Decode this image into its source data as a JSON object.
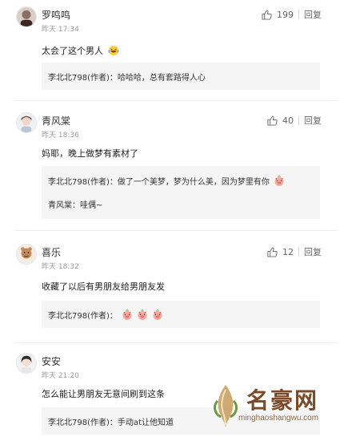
{
  "comments": [
    {
      "name": "罗鸣鸣",
      "time": "昨天 17:34",
      "likes": "199",
      "reply_label": "回复",
      "text": "太会了这个男人",
      "replies": [
        {
          "text": "李北北798(作者)：哈哈哈，总有套路得人心"
        }
      ]
    },
    {
      "name": "青风棠",
      "time": "昨天 18:36",
      "likes": "40",
      "reply_label": "回复",
      "text": "妈耶，晚上做梦有素材了",
      "replies": [
        {
          "text": "李北北798(作者)：做了一个美梦，梦为什么美，因为梦里有你"
        },
        {
          "text": "青风棠：哇偶~"
        }
      ]
    },
    {
      "name": "喜乐",
      "time": "昨天 18:32",
      "likes": "12",
      "reply_label": "回复",
      "text": "收藏了以后有男朋友给男朋友发",
      "replies": [
        {
          "text": "李北北798(作者)："
        }
      ]
    },
    {
      "name": "安安",
      "time": "昨天 21:20",
      "reply_label": "回复",
      "text": "怎么能让男朋友无意间刷到这条",
      "replies": [
        {
          "text": "李北北798(作者)：手动at让他知道"
        }
      ]
    }
  ],
  "watermark": {
    "title": "名豪网",
    "subtitle": "minghaoshangwu.com"
  },
  "colors": {
    "reply_bg": "#f5f5f5",
    "muted": "#9a9a9a",
    "watermark": "#7a4a2a"
  },
  "icons": {
    "like": "thumbs-up-icon",
    "emoji_laugh": "laughing-emoji-icon",
    "emoji_pig": "pig-emoji-icon"
  }
}
